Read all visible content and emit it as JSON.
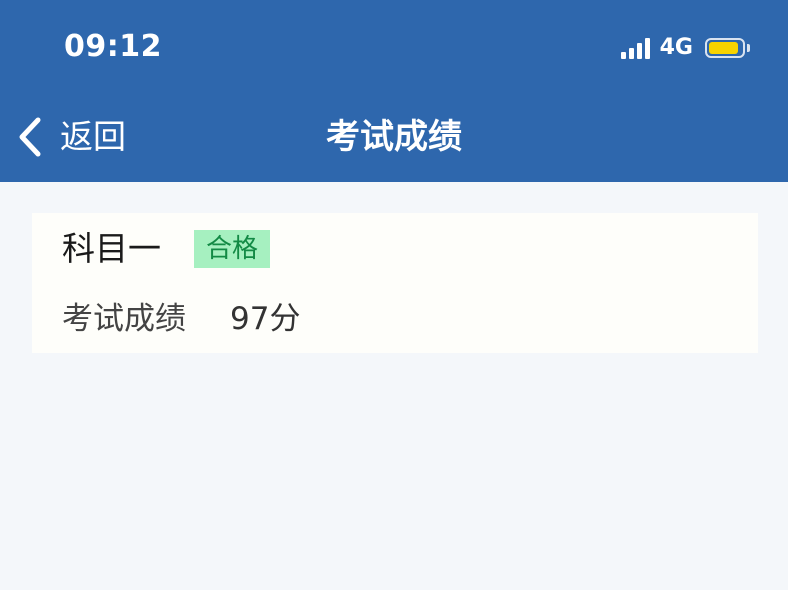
{
  "status_bar": {
    "time": "09:12",
    "network": "4G",
    "signal_icon": "signal-bars-icon",
    "battery_icon": "battery-icon",
    "battery_level": 0.9,
    "battery_color": "#f7d300"
  },
  "nav": {
    "back_label": "返回",
    "back_icon": "chevron-left-icon",
    "title": "考试成绩",
    "background_color": "#2e67ad"
  },
  "result": {
    "subject": "科目一",
    "status": "合格",
    "status_color": "#138a45",
    "status_bg": "#a6f0c0",
    "score_label": "考试成绩",
    "score_value": "97分"
  }
}
